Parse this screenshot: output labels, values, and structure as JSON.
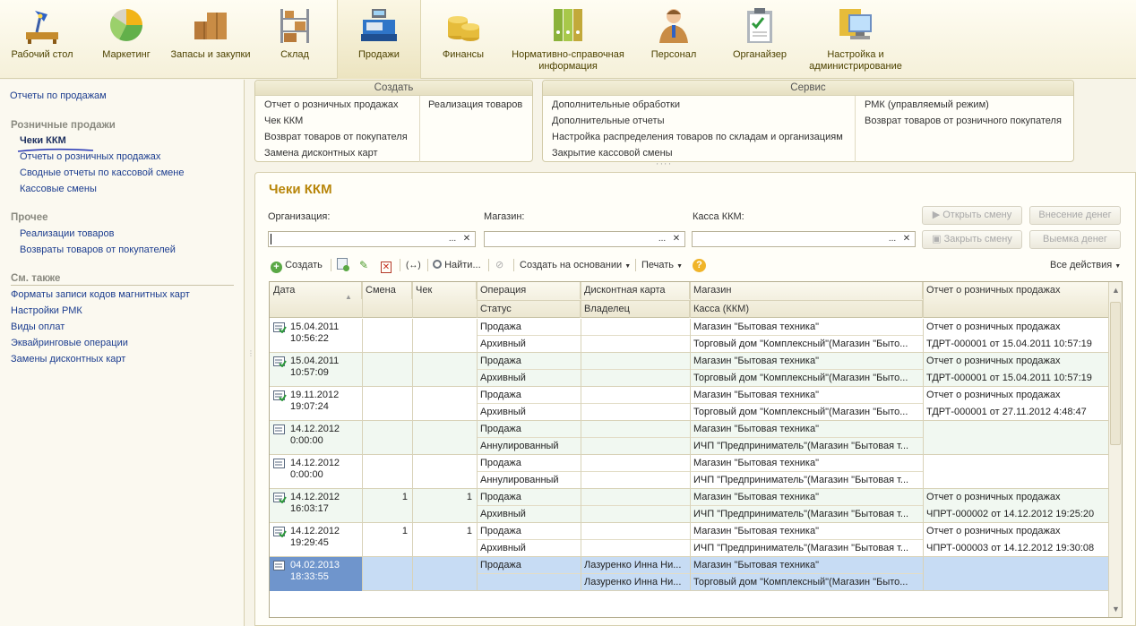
{
  "sections": [
    {
      "label": "Рабочий стол",
      "icon": "desk-lamp-icon"
    },
    {
      "label": "Маркетинг",
      "icon": "pie-chart-icon"
    },
    {
      "label": "Запасы и закупки",
      "icon": "boxes-icon"
    },
    {
      "label": "Склад",
      "icon": "warehouse-shelf-icon"
    },
    {
      "label": "Продажи",
      "icon": "cash-register-icon"
    },
    {
      "label": "Финансы",
      "icon": "coins-icon"
    },
    {
      "label": "Нормативно-справочная информация",
      "icon": "binders-icon"
    },
    {
      "label": "Персонал",
      "icon": "person-icon"
    },
    {
      "label": "Органайзер",
      "icon": "clipboard-icon"
    },
    {
      "label": "Настройка и администрирование",
      "icon": "computer-icon"
    }
  ],
  "left_panel": {
    "top_link": "Отчеты по продажам",
    "groups": [
      {
        "title": "Розничные продажи",
        "items": [
          "Чеки ККМ",
          "Отчеты о розничных продажах",
          "Сводные отчеты по кассовой смене",
          "Кассовые смены"
        ]
      },
      {
        "title": "Прочее",
        "items": [
          "Реализации товаров",
          "Возвраты товаров от покупателей"
        ]
      },
      {
        "title": "См. также",
        "items": [
          "Форматы записи кодов магнитных карт",
          "Настройки РМК",
          "Виды оплат",
          "Эквайринговые операции",
          "Замены дисконтных карт"
        ]
      }
    ]
  },
  "create_panel": {
    "title": "Создать",
    "col1": [
      "Отчет о розничных продажах",
      "Чек ККМ",
      "Возврат товаров от покупателя",
      "Замена дисконтных карт"
    ],
    "col2": [
      "Реализация товаров"
    ]
  },
  "service_panel": {
    "title": "Сервис",
    "col1": [
      "Дополнительные обработки",
      "Дополнительные отчеты",
      "Настройка распределения товаров по складам и организациям",
      "Закрытие кассовой смены"
    ],
    "col2": [
      "РМК (управляемый режим)",
      "Возврат товаров от розничного покупателя"
    ]
  },
  "form": {
    "title": "Чеки ККМ",
    "org_label": "Организация:",
    "store_label": "Магазин:",
    "kkm_label": "Касса ККМ:",
    "open_shift": "Открыть смену",
    "close_shift": "Закрыть смену",
    "deposit": "Внесение денег",
    "withdraw": "Выемка денег",
    "field_dots": "...",
    "field_clear": "✕"
  },
  "toolbar": {
    "create": "Создать",
    "find": "Найти...",
    "create_based": "Создать на основании",
    "print": "Печать",
    "all_actions": "Все действия",
    "help": "?"
  },
  "table": {
    "headers_top": [
      "Дата",
      "Смена",
      "Чек",
      "Операция",
      "Дисконтная карта",
      "Магазин",
      "Отчет о розничных продажах"
    ],
    "headers_bottom": [
      "Статус",
      "Владелец",
      "Касса (ККМ)"
    ],
    "rows": [
      {
        "date": "15.04.2011",
        "time": "10:56:22",
        "shift": "",
        "check": "",
        "op": "Продажа",
        "status": "Архивный",
        "card": "",
        "owner": "",
        "store": "Магазин \"Бытовая техника\"",
        "kkm": "Торговый дом \"Комплексный\"(Магазин \"Быто...",
        "report1": "Отчет о розничных продажах",
        "report2": "ТДРТ-000001 от 15.04.2011 10:57:19",
        "posted": true
      },
      {
        "date": "15.04.2011",
        "time": "10:57:09",
        "shift": "",
        "check": "",
        "op": "Продажа",
        "status": "Архивный",
        "card": "",
        "owner": "",
        "store": "Магазин \"Бытовая техника\"",
        "kkm": "Торговый дом \"Комплексный\"(Магазин \"Быто...",
        "report1": "Отчет о розничных продажах",
        "report2": "ТДРТ-000001 от 15.04.2011 10:57:19",
        "posted": true
      },
      {
        "date": "19.11.2012",
        "time": "19:07:24",
        "shift": "",
        "check": "",
        "op": "Продажа",
        "status": "Архивный",
        "card": "",
        "owner": "",
        "store": "Магазин \"Бытовая техника\"",
        "kkm": "Торговый дом \"Комплексный\"(Магазин \"Быто...",
        "report1": "Отчет о розничных продажах",
        "report2": "ТДРТ-000001 от 27.11.2012 4:48:47",
        "posted": true
      },
      {
        "date": "14.12.2012",
        "time": "0:00:00",
        "shift": "",
        "check": "",
        "op": "Продажа",
        "status": "Аннулированный",
        "card": "",
        "owner": "",
        "store": "Магазин \"Бытовая техника\"",
        "kkm": "ИЧП \"Предприниматель\"(Магазин \"Бытовая т...",
        "report1": "",
        "report2": "",
        "posted": false
      },
      {
        "date": "14.12.2012",
        "time": "0:00:00",
        "shift": "",
        "check": "",
        "op": "Продажа",
        "status": "Аннулированный",
        "card": "",
        "owner": "",
        "store": "Магазин \"Бытовая техника\"",
        "kkm": "ИЧП \"Предприниматель\"(Магазин \"Бытовая т...",
        "report1": "",
        "report2": "",
        "posted": false
      },
      {
        "date": "14.12.2012",
        "time": "16:03:17",
        "shift": "1",
        "check": "1",
        "op": "Продажа",
        "status": "Архивный",
        "card": "",
        "owner": "",
        "store": "Магазин \"Бытовая техника\"",
        "kkm": "ИЧП \"Предприниматель\"(Магазин \"Бытовая т...",
        "report1": "Отчет о розничных продажах",
        "report2": "ЧПРТ-000002 от 14.12.2012 19:25:20",
        "posted": true
      },
      {
        "date": "14.12.2012",
        "time": "19:29:45",
        "shift": "1",
        "check": "1",
        "op": "Продажа",
        "status": "Архивный",
        "card": "",
        "owner": "",
        "store": "Магазин \"Бытовая техника\"",
        "kkm": "ИЧП \"Предприниматель\"(Магазин \"Бытовая т...",
        "report1": "Отчет о розничных продажах",
        "report2": "ЧПРТ-000003 от 14.12.2012 19:30:08",
        "posted": true
      },
      {
        "date": "04.02.2013",
        "time": "18:33:55",
        "shift": "",
        "check": "",
        "op": "Продажа",
        "status": "",
        "card": "Лазуренко Инна Ни...",
        "owner": "Лазуренко Инна Ни...",
        "store": "Магазин \"Бытовая техника\"",
        "kkm": "Торговый дом \"Комплексный\"(Магазин \"Быто...",
        "report1": "",
        "report2": "",
        "posted": false
      }
    ]
  },
  "colors": {
    "accent_title": "#b8860b",
    "link": "#1c3d8f",
    "selected_row": "#c7dcf4",
    "alt_row": "#f1f8f1"
  }
}
